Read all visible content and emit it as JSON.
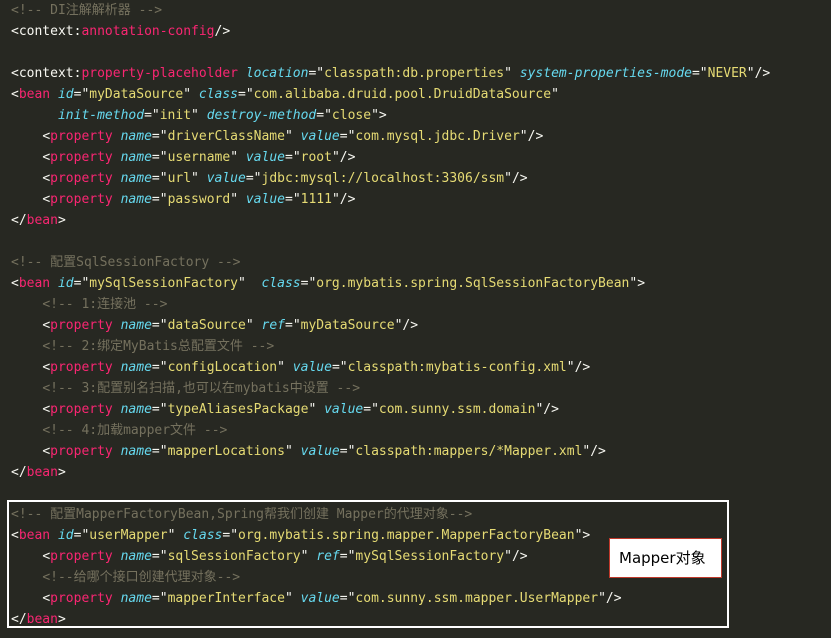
{
  "lines": [
    "<!-- DI注解解析器 -->",
    "<context:annotation-config/>",
    "",
    "<context:property-placeholder location=\"classpath:db.properties\" system-properties-mode=\"NEVER\"/>",
    "<bean id=\"myDataSource\" class=\"com.alibaba.druid.pool.DruidDataSource\"",
    "      init-method=\"init\" destroy-method=\"close\">",
    "    <property name=\"driverClassName\" value=\"com.mysql.jdbc.Driver\"/>",
    "    <property name=\"username\" value=\"root\"/>",
    "    <property name=\"url\" value=\"jdbc:mysql://localhost:3306/ssm\"/>",
    "    <property name=\"password\" value=\"1111\"/>",
    "</bean>",
    "",
    "<!-- 配置SqlSessionFactory -->",
    "<bean id=\"mySqlSessionFactory\"  class=\"org.mybatis.spring.SqlSessionFactoryBean\">",
    "    <!-- 1:连接池 -->",
    "    <property name=\"dataSource\" ref=\"myDataSource\"/>",
    "    <!-- 2:绑定MyBatis总配置文件 -->",
    "    <property name=\"configLocation\" value=\"classpath:mybatis-config.xml\"/>",
    "    <!-- 3:配置别名扫描,也可以在mybatis中设置 -->",
    "    <property name=\"typeAliasesPackage\" value=\"com.sunny.ssm.domain\"/>",
    "    <!-- 4:加载mapper文件 -->",
    "    <property name=\"mapperLocations\" value=\"classpath:mappers/*Mapper.xml\"/>",
    "</bean>",
    "",
    "<!-- 配置MapperFactoryBean,Spring帮我们创建 Mapper的代理对象-->",
    "<bean id=\"userMapper\" class=\"org.mybatis.spring.mapper.MapperFactoryBean\">",
    "    <property name=\"sqlSessionFactory\" ref=\"mySqlSessionFactory\"/>",
    "    <!--给哪个接口创建代理对象-->",
    "    <property name=\"mapperInterface\" value=\"com.sunny.ssm.mapper.UserMapper\"/>",
    "</bean>"
  ],
  "callout": {
    "label": "Mapper对象"
  },
  "colors": {
    "background": "#272822",
    "comment": "#75715e",
    "tag": "#f92672",
    "attribute": "#66d9ef",
    "string": "#e6db74",
    "plain": "#f8f8f2",
    "highlight_border": "#ffffff",
    "callout_border": "#c0392b"
  }
}
